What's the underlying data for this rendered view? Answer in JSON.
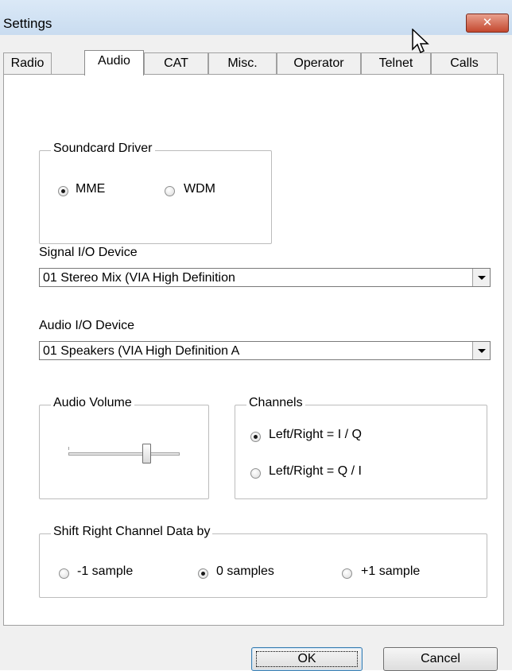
{
  "window": {
    "title": "Settings",
    "close_glyph": "✕"
  },
  "tabs": [
    {
      "label": "Radio"
    },
    {
      "label": "Audio",
      "active": true
    },
    {
      "label": "CAT"
    },
    {
      "label": "Misc."
    },
    {
      "label": "Operator"
    },
    {
      "label": "Telnet"
    },
    {
      "label": "Calls"
    }
  ],
  "soundcard": {
    "legend": "Soundcard Driver",
    "options": [
      {
        "label": "MME",
        "checked": true
      },
      {
        "label": "WDM",
        "checked": false
      }
    ]
  },
  "signal_io": {
    "label": "Signal I/O Device",
    "value": "01  Stereo Mix (VIA High Definition"
  },
  "audio_io": {
    "label": "Audio I/O Device",
    "value": "01  Speakers (VIA High Definition A"
  },
  "volume": {
    "legend": "Audio Volume",
    "level": 0.72
  },
  "channels": {
    "legend": "Channels",
    "options": [
      {
        "label": "Left/Right = I / Q",
        "checked": true
      },
      {
        "label": "Left/Right = Q / I",
        "checked": false
      }
    ]
  },
  "shift": {
    "legend": "Shift Right Channel Data by",
    "options": [
      {
        "label": "-1 sample",
        "checked": false
      },
      {
        "label": "0 samples",
        "checked": true
      },
      {
        "label": "+1 sample",
        "checked": false
      }
    ]
  },
  "buttons": {
    "ok": "OK",
    "cancel": "Cancel"
  },
  "icons": {
    "close": "close-icon",
    "cursor": "mouse-cursor-icon",
    "dropdown": "chevron-down-icon"
  }
}
